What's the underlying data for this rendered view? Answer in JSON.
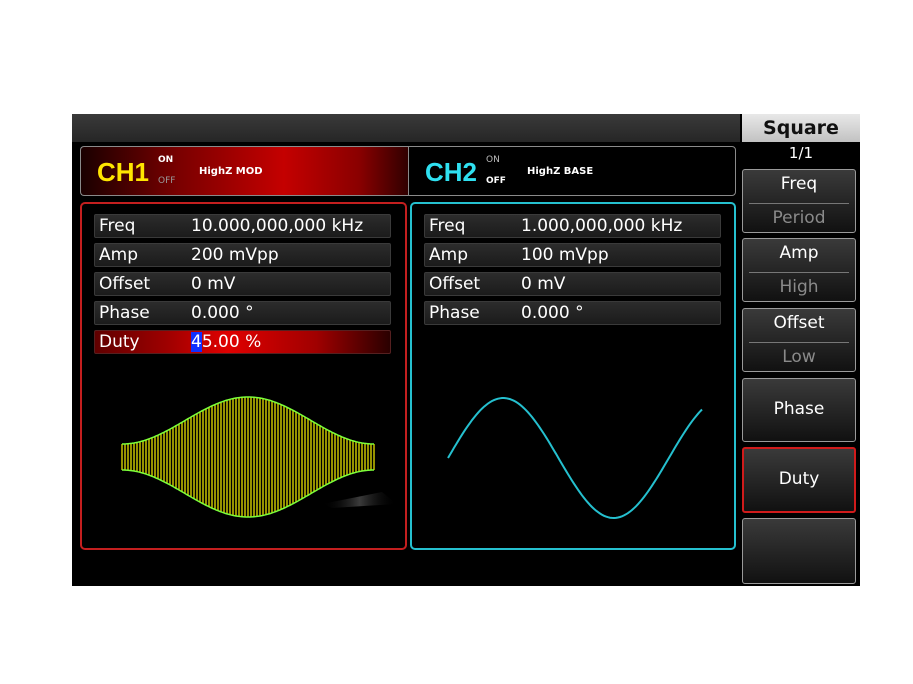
{
  "menu": {
    "title": "Square",
    "page": "1/1",
    "keys": [
      {
        "top": "Freq",
        "bottom": "Period"
      },
      {
        "top": "Amp",
        "bottom": "High"
      },
      {
        "top": "Offset",
        "bottom": "Low"
      },
      {
        "label": "Phase"
      },
      {
        "label": "Duty",
        "selected": true
      },
      {
        "label": ""
      }
    ]
  },
  "ch1": {
    "name": "CH1",
    "on": "ON",
    "off": "OFF",
    "status": "HighZ  MOD",
    "params": [
      {
        "label": "Freq",
        "value": "10.000,000,000 kHz"
      },
      {
        "label": "Amp",
        "value": "200 mVpp"
      },
      {
        "label": "Offset",
        "value": "0 mV"
      },
      {
        "label": "Phase",
        "value": "0.000 °"
      },
      {
        "label": "Duty",
        "value_cursor": "4",
        "value_rest": "5.00 %",
        "active": true
      }
    ],
    "waveform": "amplitude-modulated square wave",
    "colors": {
      "wave": "#e8e000",
      "envelope": "#7cff3a",
      "border": "#c41f1f"
    }
  },
  "ch2": {
    "name": "CH2",
    "on": "ON",
    "off": "OFF",
    "status": "HighZ  BASE",
    "params": [
      {
        "label": "Freq",
        "value": "1.000,000,000 kHz"
      },
      {
        "label": "Amp",
        "value": "100 mVpp"
      },
      {
        "label": "Offset",
        "value": "0 mV"
      },
      {
        "label": "Phase",
        "value": "0.000 °"
      }
    ],
    "waveform": "sine wave",
    "colors": {
      "wave": "#25c0cf",
      "border": "#25c0cf"
    }
  }
}
